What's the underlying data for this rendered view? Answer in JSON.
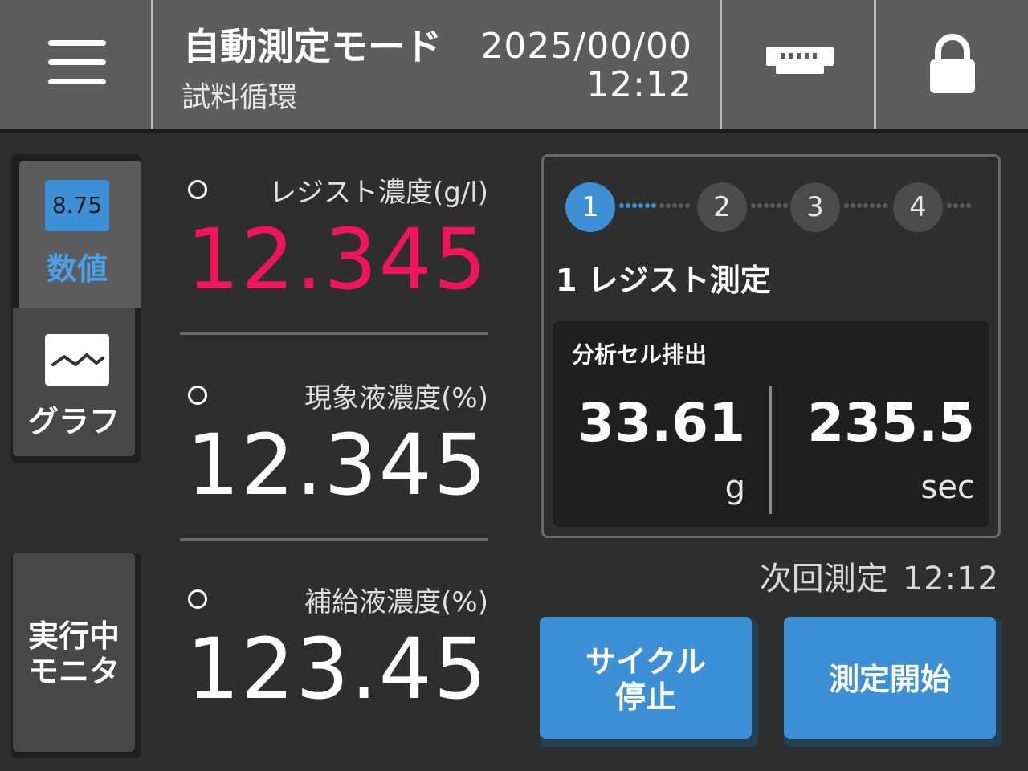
{
  "header": {
    "mode_title": "自動測定モード",
    "mode_subtitle": "試料循環",
    "date": "2025/00/00",
    "time": "12:12",
    "menu_icon": "hamburger-menu-icon",
    "network_icon": "ethernet-icon",
    "lock_icon": "lock-icon"
  },
  "nav": {
    "numeric": {
      "badge": "8.75",
      "label": "数値",
      "active": true
    },
    "graph": {
      "label": "グラフ",
      "icon": "graph-icon"
    },
    "monitor": {
      "line1": "実行中",
      "line2": "モニタ"
    }
  },
  "readings": [
    {
      "name": "レジスト濃度(g/l)",
      "value": "12.345",
      "color": "#f0145a"
    },
    {
      "name": "現象液濃度(%)",
      "value": "12.345",
      "color": "#ffffff"
    },
    {
      "name": "補給液濃度(%)",
      "value": "123.45",
      "color": "#ffffff"
    }
  ],
  "steps": {
    "items": [
      "1",
      "2",
      "3",
      "4"
    ],
    "active_index": 0,
    "current_title": "1 レジスト測定"
  },
  "process": {
    "title": "分析セル排出",
    "weight_value": "33.61",
    "weight_unit": "g",
    "time_value": "235.5",
    "time_unit": "sec"
  },
  "next_measure": {
    "label": "次回測定",
    "time": "12:12"
  },
  "buttons": {
    "cycle_stop": {
      "line1": "サイクル",
      "line2": "停止"
    },
    "start": {
      "label": "測定開始"
    }
  },
  "colors": {
    "accent": "#3d8fd6",
    "alert": "#f0145a",
    "header": "#5d5d5d",
    "background": "#2e2e2e"
  }
}
